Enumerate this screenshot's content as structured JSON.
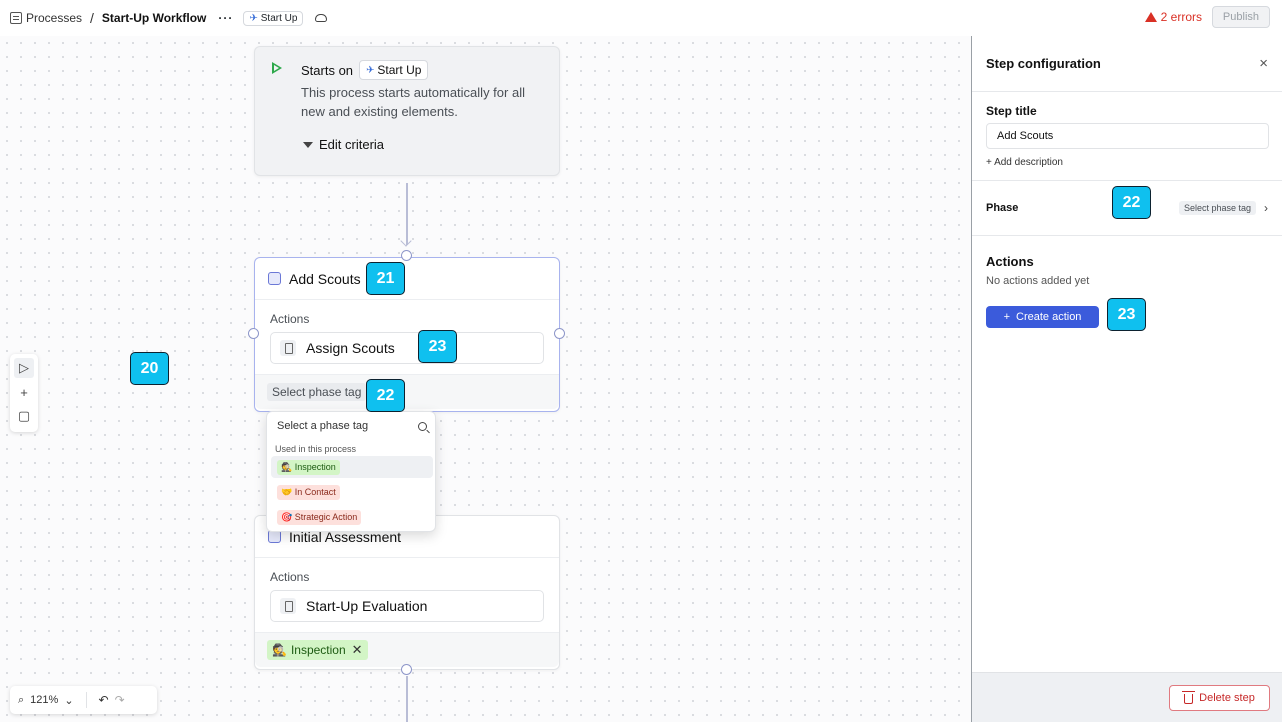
{
  "topbar": {
    "breadcrumb_root": "Processes",
    "separator": "/",
    "title": "Start-Up Workflow",
    "more": "···",
    "entity_tag": "Start Up",
    "errors": "2 errors",
    "publish": "Publish"
  },
  "trigger": {
    "starts_on": "Starts on",
    "tag": "Start Up",
    "description": "This process starts automatically for all new and existing elements.",
    "edit_criteria": "Edit criteria"
  },
  "steps": [
    {
      "title": "Add Scouts",
      "actions_label": "Actions",
      "action": "Assign Scouts",
      "phase_button": "Select phase tag"
    },
    {
      "title": "Initial Assessment",
      "actions_label": "Actions",
      "action": "Start-Up Evaluation",
      "phase_tag": "Inspection",
      "phase_tag_remove": "✕"
    }
  ],
  "dropdown": {
    "placeholder": "Select a phase tag",
    "section": "Used in this process",
    "items": [
      {
        "label": "Inspection",
        "emoji": "🕵"
      },
      {
        "label": "In Contact",
        "emoji": "🤝"
      },
      {
        "label": "Strategic Action",
        "emoji": "🎯"
      }
    ]
  },
  "canvas_tools": {
    "select": "▷",
    "add": "+",
    "note": "▢"
  },
  "zoom": {
    "level": "121%",
    "chevron": "⌄",
    "undo": "↶",
    "redo": "↷"
  },
  "panel": {
    "title": "Step configuration",
    "close": "×",
    "step_title_label": "Step title",
    "step_title_value": "Add Scouts",
    "add_description": "+  Add description",
    "phase_label": "Phase",
    "phase_value": "Select phase tag",
    "phase_chevron": "›",
    "actions_title": "Actions",
    "no_actions": "No actions added yet",
    "create_action": "Create action",
    "create_plus": "+",
    "delete_step": "Delete step"
  },
  "markers": {
    "m20": "20",
    "m21": "21",
    "m22a": "22",
    "m22b": "22",
    "m23a": "23",
    "m23b": "23"
  },
  "colors": {
    "accent": "#3b5bdb",
    "error": "#d93025",
    "start_green": "#2ea84b",
    "marker_fill": "#0fc0ef",
    "inspection_bg": "#d3f5c6",
    "contact_bg": "#fde0dc"
  }
}
